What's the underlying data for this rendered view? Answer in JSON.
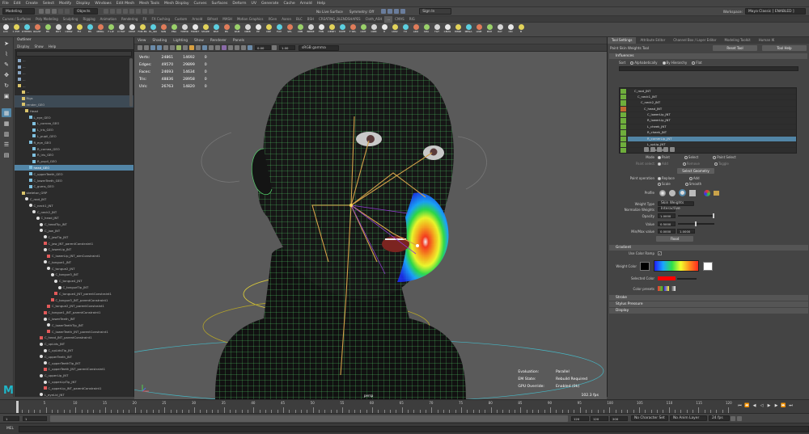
{
  "menubar": {
    "items": [
      "File",
      "Edit",
      "Create",
      "Select",
      "Modify",
      "Display",
      "Windows",
      "Edit Mesh",
      "Mesh Tools",
      "Mesh Display",
      "Curves",
      "Surfaces",
      "Deform",
      "UV",
      "Generate",
      "Cache",
      "Arnold",
      "Help"
    ],
    "workspace_label": "Workspace:",
    "workspace_value": "Maya Classic [ ENABLED ]"
  },
  "statusline": {
    "mode": "Modeling",
    "objects_label": "Objects",
    "live_surface": "No Live Surface",
    "symmetry": "Symmetry: Off",
    "signin": "Sign In"
  },
  "shelf": {
    "tabs": [
      "Curves / Surfaces",
      "Poly Modeling",
      "Sculpting",
      "Rigging",
      "Animation",
      "Rendering",
      "FX",
      "FX Caching",
      "Custom",
      "Arnold",
      "Bifrost",
      "MASH",
      "Motion Graphics",
      "XGen",
      "Aaron",
      "BLC",
      "BSH",
      "CREATING_BLENDSHAPES",
      "Cloth_ASH",
      "...",
      "CMAS",
      "RIG"
    ],
    "active_tab": "...",
    "buttons": [
      "LOC",
      "C EYE",
      "OTHERS",
      "RIGHT",
      "BS",
      "BUT",
      "CRSW",
      "FIX",
      "BS",
      "MERG",
      "F LIP",
      "D HAT",
      "CRSH",
      "FOR BS",
      "PL_SKI",
      "SKN",
      "PNA",
      "TWEIR",
      "FRONT",
      "SHAPE",
      "BSH",
      "BS",
      "RAM",
      "NIRB",
      "EP",
      "CRE",
      "FLIP",
      "SEL",
      "CRB",
      "BIRRE",
      "FRN",
      "DENTI",
      "HATE",
      "T SEL",
      "CRIT",
      "ORM",
      "H",
      "UNIV",
      "TO",
      "ARO",
      "SDA",
      "TGT",
      "CMAS",
      "HIMM",
      "MEGA",
      "LINE",
      "BSH",
      "RAY",
      "CRI",
      "B"
    ]
  },
  "outliner": {
    "title": "Outliner",
    "menu": [
      "Display",
      "Show",
      "Help"
    ],
    "rows": [
      {
        "indent": 0,
        "text": "...",
        "icon": "cam",
        "state": ""
      },
      {
        "indent": 0,
        "text": "...",
        "icon": "cam",
        "state": ""
      },
      {
        "indent": 0,
        "text": "...",
        "icon": "cam",
        "state": ""
      },
      {
        "indent": 0,
        "text": "...",
        "icon": "cam",
        "state": ""
      },
      {
        "indent": 0,
        "text": "...",
        "icon": "grp",
        "state": ""
      },
      {
        "indent": 1,
        "text": "...",
        "icon": "grp",
        "state": ""
      },
      {
        "indent": 1,
        "text": "Rigs",
        "icon": "grp",
        "state": "hl"
      },
      {
        "indent": 1,
        "text": "render_GEO",
        "icon": "grp",
        "state": "hl"
      },
      {
        "indent": 2,
        "text": "Head",
        "icon": "grp",
        "state": ""
      },
      {
        "indent": 3,
        "text": "L_eye_GEO",
        "icon": "mesh",
        "state": ""
      },
      {
        "indent": 4,
        "text": "L_cornea_GEO",
        "icon": "mesh",
        "state": ""
      },
      {
        "indent": 4,
        "text": "L_iris_GEO",
        "icon": "mesh",
        "state": ""
      },
      {
        "indent": 4,
        "text": "L_pupil_GEO",
        "icon": "mesh",
        "state": ""
      },
      {
        "indent": 3,
        "text": "R_eye_GEO",
        "icon": "mesh",
        "state": ""
      },
      {
        "indent": 4,
        "text": "R_cornea_GEO",
        "icon": "mesh",
        "state": ""
      },
      {
        "indent": 4,
        "text": "R_iris_GEO",
        "icon": "mesh",
        "state": ""
      },
      {
        "indent": 4,
        "text": "R_pupil_GEO",
        "icon": "mesh",
        "state": ""
      },
      {
        "indent": 3,
        "text": "head_GEO",
        "icon": "mesh",
        "state": "sel"
      },
      {
        "indent": 3,
        "text": "C_upperTeeth_GEO",
        "icon": "mesh",
        "state": ""
      },
      {
        "indent": 3,
        "text": "C_lowerTeeth_GEO",
        "icon": "mesh",
        "state": ""
      },
      {
        "indent": 3,
        "text": "C_gums_GEO",
        "icon": "mesh",
        "state": ""
      },
      {
        "indent": 1,
        "text": "skeleton_GRP",
        "icon": "grp",
        "state": ""
      },
      {
        "indent": 2,
        "text": "C_root_JNT",
        "icon": "jnt",
        "state": ""
      },
      {
        "indent": 3,
        "text": "C_neck1_JNT",
        "icon": "jnt",
        "state": ""
      },
      {
        "indent": 4,
        "text": "C_neck2_JNT",
        "icon": "jnt",
        "state": ""
      },
      {
        "indent": 5,
        "text": "C_head_JNT",
        "icon": "jnt",
        "state": ""
      },
      {
        "indent": 6,
        "text": "C_headTip_JNT",
        "icon": "jnt",
        "state": ""
      },
      {
        "indent": 6,
        "text": "C_jaw_JNT",
        "icon": "jnt",
        "state": ""
      },
      {
        "indent": 7,
        "text": "C_jawTip_JNT",
        "icon": "jnt",
        "state": ""
      },
      {
        "indent": 7,
        "text": "C_jaw_JNT_parentConstraint1",
        "icon": "cns",
        "state": ""
      },
      {
        "indent": 7,
        "text": "C_lowerLip_JNT",
        "icon": "jnt",
        "state": ""
      },
      {
        "indent": 8,
        "text": "C_lowerLip_JNT_aimConstraint1",
        "icon": "cns",
        "state": ""
      },
      {
        "indent": 7,
        "text": "C_tongue1_JNT",
        "icon": "jnt",
        "state": ""
      },
      {
        "indent": 8,
        "text": "C_tongue2_JNT",
        "icon": "jnt",
        "state": ""
      },
      {
        "indent": 9,
        "text": "C_tongue3_JNT",
        "icon": "jnt",
        "state": ""
      },
      {
        "indent": 10,
        "text": "C_tongue4_JNT",
        "icon": "jnt",
        "state": ""
      },
      {
        "indent": 11,
        "text": "C_tongueTip_JNT",
        "icon": "jnt",
        "state": ""
      },
      {
        "indent": 10,
        "text": "C_tongue4_JNT_parentConstraint1",
        "icon": "cns",
        "state": ""
      },
      {
        "indent": 9,
        "text": "C_tongue3_JNT_parentConstraint1",
        "icon": "cns",
        "state": ""
      },
      {
        "indent": 8,
        "text": "C_tongue2_JNT_parentConstraint1",
        "icon": "cns",
        "state": ""
      },
      {
        "indent": 7,
        "text": "C_tongue1_JNT_parentConstraint1",
        "icon": "cns",
        "state": ""
      },
      {
        "indent": 7,
        "text": "C_lowerTeeth_JNT",
        "icon": "jnt",
        "state": ""
      },
      {
        "indent": 8,
        "text": "C_lowerTeethTip_JNT",
        "icon": "jnt",
        "state": ""
      },
      {
        "indent": 8,
        "text": "C_lowerTeeth_JNT_parentConstraint1",
        "icon": "cns",
        "state": ""
      },
      {
        "indent": 6,
        "text": "C_head_JNT_parentConstraint1",
        "icon": "cns",
        "state": ""
      },
      {
        "indent": 6,
        "text": "C_upLids_JNT",
        "icon": "jnt",
        "state": ""
      },
      {
        "indent": 7,
        "text": "C_upLidsTip_JNT",
        "icon": "jnt",
        "state": ""
      },
      {
        "indent": 6,
        "text": "C_upperTeeth_JNT",
        "icon": "jnt",
        "state": ""
      },
      {
        "indent": 7,
        "text": "C_upperTeethTip_JNT",
        "icon": "jnt",
        "state": ""
      },
      {
        "indent": 7,
        "text": "C_upperTeeth_JNT_parentConstraint1",
        "icon": "cns",
        "state": ""
      },
      {
        "indent": 6,
        "text": "C_upperLip_JNT",
        "icon": "jnt",
        "state": ""
      },
      {
        "indent": 7,
        "text": "C_upperLipTip_JNT",
        "icon": "jnt",
        "state": ""
      },
      {
        "indent": 7,
        "text": "C_upperLip_JNT_parentConstraint1",
        "icon": "cns",
        "state": ""
      },
      {
        "indent": 6,
        "text": "L_eyeLid_JNT",
        "icon": "jnt",
        "state": ""
      }
    ]
  },
  "viewport": {
    "menu": [
      "View",
      "Shading",
      "Lighting",
      "Show",
      "Renderer",
      "Panels"
    ],
    "camera_value": "0.00",
    "zoom_value": "1.00",
    "colorspace": "sRGB gamma",
    "stats": [
      [
        "Verts:",
        "24861",
        "14692",
        "0"
      ],
      [
        "Edges:",
        "49570",
        "29899",
        "0"
      ],
      [
        "Faces:",
        "24693",
        "14634",
        "0"
      ],
      [
        "Tris:",
        "48836",
        "28958",
        "0"
      ],
      [
        "UVs:",
        "26763",
        "14820",
        "0"
      ]
    ],
    "eval": [
      [
        "Evaluation:",
        "Parallel"
      ],
      [
        "EM State:",
        "Rebuild Required"
      ],
      [
        "GPU Override:",
        "Enabled (0k)"
      ]
    ],
    "fps": "102.3 fps",
    "cam_label": "persp"
  },
  "attribute": {
    "tabs": [
      "Tool Settings",
      "Attribute Editor",
      "Channel Box / Layer Editor",
      "Modeling Toolkit",
      "Human IK"
    ],
    "tool_name": "Paint Skin Weights Tool",
    "reset_label": "Reset Tool",
    "help_label": "Tool Help",
    "influences_label": "Influences",
    "sort_label": "Sort",
    "sort_opts": [
      "Alphabetically",
      "By Hierarchy",
      "Flat"
    ],
    "filter_placeholder": "",
    "joints": [
      {
        "name": "C_root_JNT",
        "color": "#6fae3c",
        "sel": false
      },
      {
        "name": "C_neck1_JNT",
        "color": "#6fae3c",
        "sel": false
      },
      {
        "name": "C_neck2_JNT",
        "color": "#6fae3c",
        "sel": false
      },
      {
        "name": "C_head_JNT",
        "color": "#c06a30",
        "sel": false
      },
      {
        "name": "C_lowerLip_JNT",
        "color": "#6fae3c",
        "sel": false
      },
      {
        "name": "R_lowerLip_JNT",
        "color": "#6fae3c",
        "sel": false
      },
      {
        "name": "L_cheek_JNT",
        "color": "#6fae3c",
        "sel": false
      },
      {
        "name": "R_cheek_JNT",
        "color": "#6fae3c",
        "sel": false
      },
      {
        "name": "R_cornerLip_JNT",
        "color": "#6fae3c",
        "sel": true
      },
      {
        "name": "L_upLip_JNT",
        "color": "#6fae3c",
        "sel": false
      },
      {
        "name": "R_cheek_JNT",
        "color": "#6fae3c",
        "sel": false
      },
      {
        "name": "R_cornerLip_JNT",
        "color": "#6fae3c",
        "sel": false
      }
    ],
    "mode_label": "Mode",
    "mode_opts": [
      "Paint",
      "Select",
      "Paint Select"
    ],
    "paint_select_label": "Paint select",
    "ps_opts": [
      "Add",
      "Remove",
      "Toggle"
    ],
    "select_geometry": "Select Geometry",
    "paint_op_label": "Paint operation",
    "po_opts": [
      "Replace",
      "Add",
      "Scale",
      "Smooth"
    ],
    "profile_label": "Profile",
    "weight_type_label": "Weight Type",
    "weight_type_value": "Skin Weights",
    "normalize_label": "Normalize Weights",
    "normalize_value": "Interactive",
    "opacity_label": "Opacity",
    "opacity_value": "1.0000",
    "value_label": "Value",
    "value_value": "0.5000",
    "minmax_label": "Min/Max value",
    "min_value": "0.0000",
    "max_value": "1.0000",
    "flood_label": "Flood",
    "gradient_label": "Gradient",
    "use_color_ramp": "Use Color Ramp",
    "weight_color_label": "Weight Color",
    "selected_color_label": "Selected Color",
    "color_presets_label": "Color presets",
    "stroke_label": "Stroke",
    "pressure_label": "Stylus Pressure",
    "display_label": "Display"
  },
  "timeline": {
    "ticks": [
      "5",
      "10",
      "15",
      "20",
      "25",
      "30",
      "35",
      "40",
      "45",
      "50",
      "55",
      "60",
      "65",
      "70",
      "75",
      "80",
      "85",
      "90",
      "95",
      "100",
      "105",
      "110",
      "115",
      "120"
    ],
    "current": "1"
  },
  "range": {
    "start": "1",
    "start2": "1",
    "end": "120",
    "end2": "120",
    "end3": "200",
    "charset": "No Character Set",
    "animlayer": "No Anim Layer",
    "fps": "24 fps"
  },
  "cmdline": {
    "mel": "MEL"
  },
  "logo": "M"
}
